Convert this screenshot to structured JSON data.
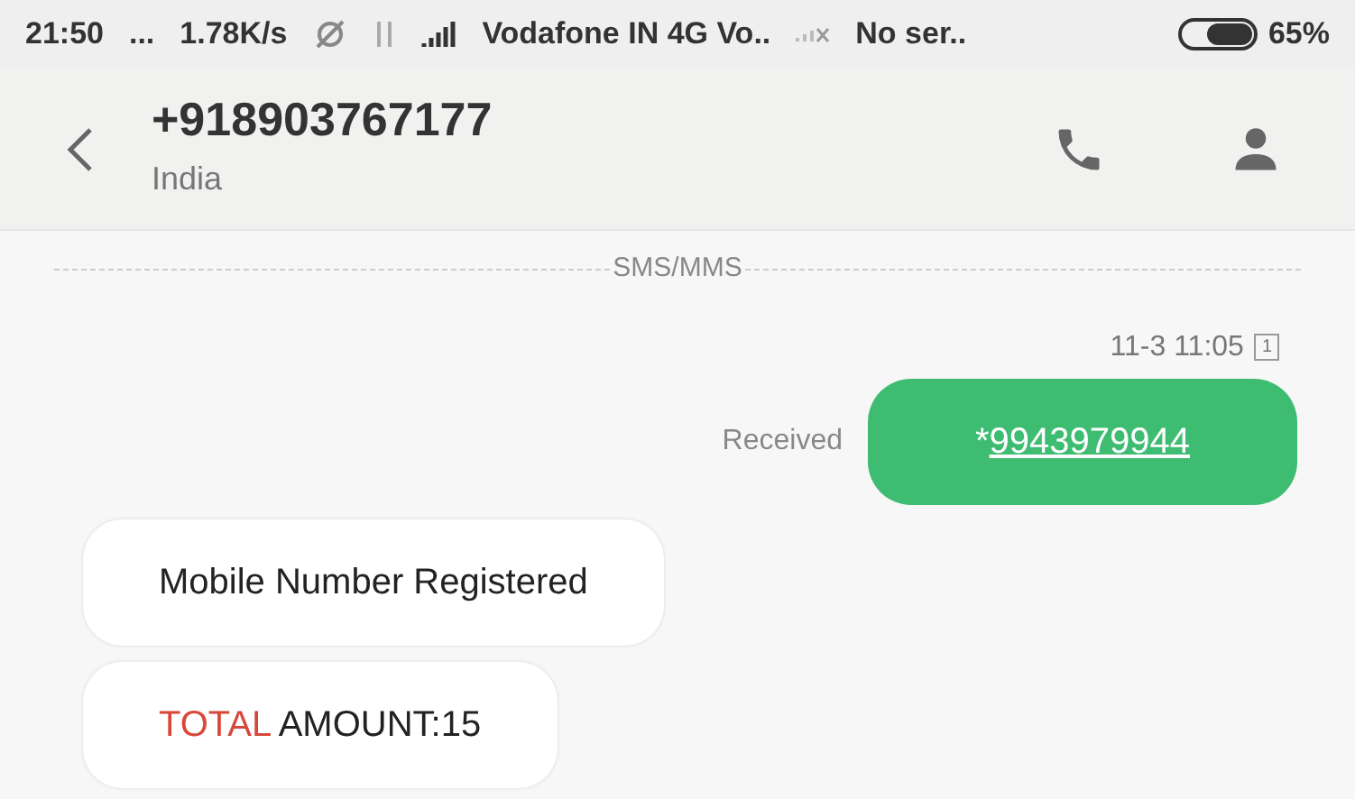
{
  "status_bar": {
    "time": "21:50",
    "dots": "...",
    "speed": "1.78K/s",
    "carrier_1": "Vodafone IN 4G Vo..",
    "carrier_2": "No ser..",
    "battery_text": "65%"
  },
  "header": {
    "contact": "+918903767177",
    "subtitle": "India"
  },
  "divider_label": "SMS/MMS",
  "timestamp": "11-3 11:05",
  "sim": "1",
  "sent": {
    "status": "Received",
    "prefix": "*",
    "link": "9943979944"
  },
  "messages": [
    {
      "segments": [
        {
          "text": "Mobile Number Registered"
        }
      ]
    },
    {
      "segments": [
        {
          "text": "TOTAL",
          "color": "#d9473a"
        },
        {
          "text": " AMOUNT:15"
        }
      ]
    }
  ]
}
